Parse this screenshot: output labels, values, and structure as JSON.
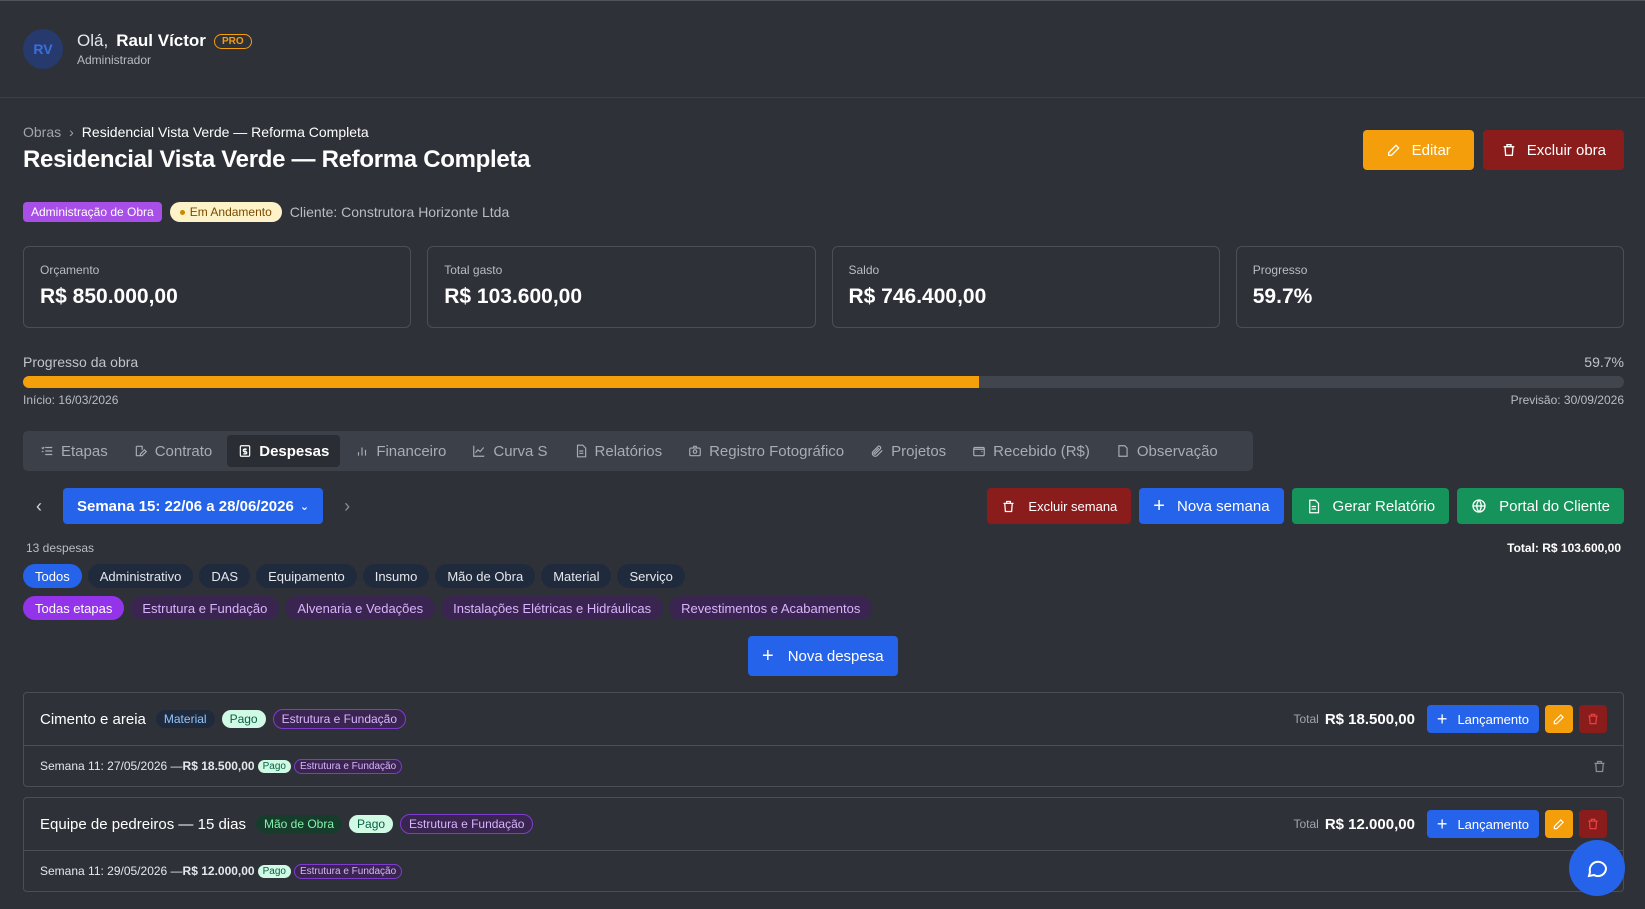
{
  "user": {
    "initials": "RV",
    "greeting": "Olá,",
    "name": "Raul Víctor",
    "badge": "PRO",
    "role": "Administrador"
  },
  "breadcrumb": {
    "root": "Obras",
    "current": "Residencial Vista Verde — Reforma Completa"
  },
  "page_title": "Residencial Vista Verde — Reforma Completa",
  "actions": {
    "edit": "Editar",
    "delete": "Excluir obra"
  },
  "tags": {
    "type": "Administração de Obra",
    "status": "Em Andamento",
    "client": "Cliente: Construtora Horizonte Ltda"
  },
  "cards": [
    {
      "label": "Orçamento",
      "value": "R$ 850.000,00"
    },
    {
      "label": "Total gasto",
      "value": "R$ 103.600,00"
    },
    {
      "label": "Saldo",
      "value": "R$ 746.400,00"
    },
    {
      "label": "Progresso",
      "value": "59.7%"
    }
  ],
  "progress": {
    "label": "Progresso da obra",
    "percent_text": "59.7%",
    "value": 0.597,
    "start": "Início: 16/03/2026",
    "forecast": "Previsão: 30/09/2026"
  },
  "tabs": [
    {
      "label": "Etapas",
      "icon": "list-icon"
    },
    {
      "label": "Contrato",
      "icon": "edit-doc-icon"
    },
    {
      "label": "Despesas",
      "icon": "dollar-doc-icon"
    },
    {
      "label": "Financeiro",
      "icon": "bar-chart-icon"
    },
    {
      "label": "Curva S",
      "icon": "line-chart-icon"
    },
    {
      "label": "Relatórios",
      "icon": "file-text-icon"
    },
    {
      "label": "Registro Fotográfico",
      "icon": "camera-icon"
    },
    {
      "label": "Projetos",
      "icon": "paperclip-icon"
    },
    {
      "label": "Recebido (R$)",
      "icon": "wallet-icon"
    },
    {
      "label": "Observação",
      "icon": "note-icon"
    }
  ],
  "week": {
    "selected": "Semana 15: 22/06 a 28/06/2026",
    "delete": "Excluir semana",
    "new": "Nova semana",
    "report": "Gerar Relatório",
    "portal": "Portal do Cliente"
  },
  "summary": {
    "count": "13 despesas",
    "total": "Total: R$ 103.600,00"
  },
  "categories": [
    "Todos",
    "Administrativo",
    "DAS",
    "Equipamento",
    "Insumo",
    "Mão de Obra",
    "Material",
    "Serviço"
  ],
  "stages": [
    "Todas etapas",
    "Estrutura e Fundação",
    "Alvenaria e Vedações",
    "Instalações Elétricas e Hidráulicas",
    "Revestimentos e Acabamentos"
  ],
  "new_expense": "Nova despesa",
  "expenses": [
    {
      "name": "Cimento e areia",
      "category": "Material",
      "status": "Pago",
      "stage": "Estrutura e Fundação",
      "total_label": "Total",
      "total": "R$ 18.500,00",
      "launch": "Lançamento",
      "entry": {
        "text": "Semana 11: 27/05/2026 — ",
        "amount": "R$ 18.500,00",
        "status": "Pago",
        "stage": "Estrutura e Fundação"
      }
    },
    {
      "name": "Equipe de pedreiros — 15 dias",
      "category": "Mão de Obra",
      "status": "Pago",
      "stage": "Estrutura e Fundação",
      "total_label": "Total",
      "total": "R$ 12.000,00",
      "launch": "Lançamento",
      "entry": {
        "text": "Semana 11: 29/05/2026 — ",
        "amount": "R$ 12.000,00",
        "status": "Pago",
        "stage": "Estrutura e Fundação"
      }
    }
  ]
}
